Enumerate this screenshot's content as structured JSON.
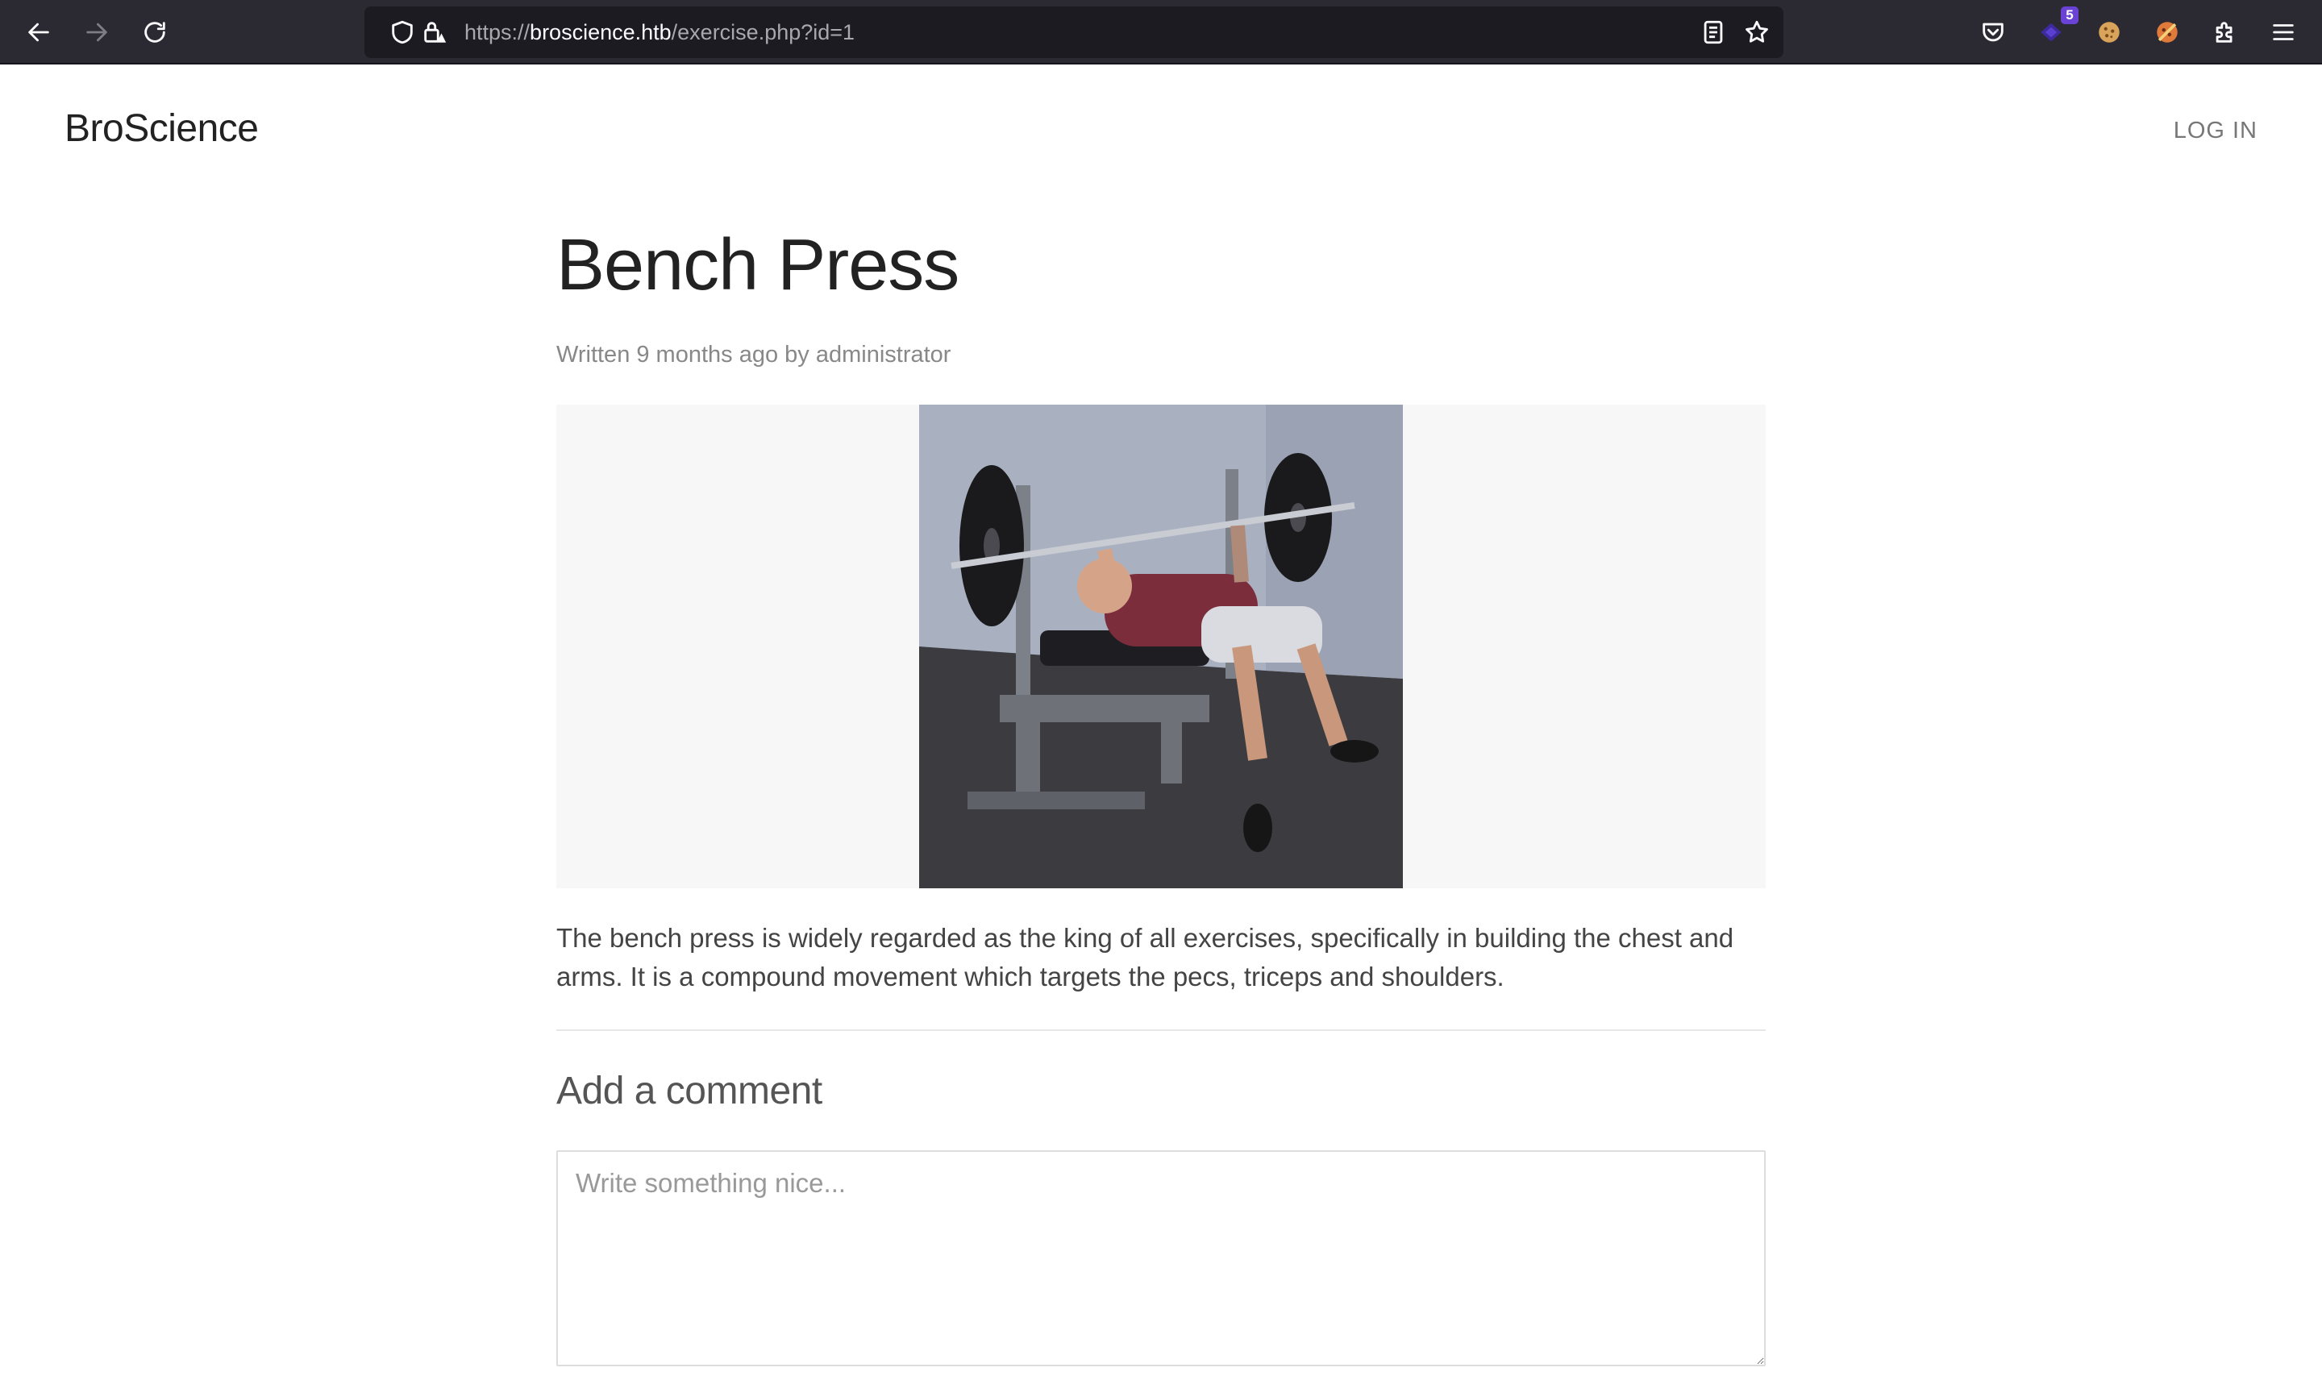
{
  "browser": {
    "url_scheme": "https://",
    "url_host": "broscience.htb",
    "url_path": "/exercise.php?id=1",
    "extension_badge": "5",
    "icons": [
      "back-arrow-icon",
      "forward-arrow-icon",
      "reload-icon",
      "shield-icon",
      "lock-warning-icon",
      "reader-view-icon",
      "star-icon",
      "pocket-icon",
      "extension-icon",
      "cookie-icon",
      "extensions-puzzle-icon",
      "menu-icon"
    ]
  },
  "site": {
    "logo": "BroScience",
    "login": "LOG IN"
  },
  "article": {
    "title": "Bench Press",
    "byline": "Written 9 months ago by administrator",
    "description": "The bench press is widely regarded as the king of all exercises, specifically in building the chest and arms. It is a compound movement which targets the pecs, triceps and shoulders."
  },
  "comment": {
    "heading": "Add a comment",
    "placeholder": "Write something nice..."
  },
  "colors": {
    "toolbar": "#2b2a33",
    "urlbar": "#1c1b22",
    "figure_bg": "#f7f7f7",
    "heading_text": "#222222"
  }
}
